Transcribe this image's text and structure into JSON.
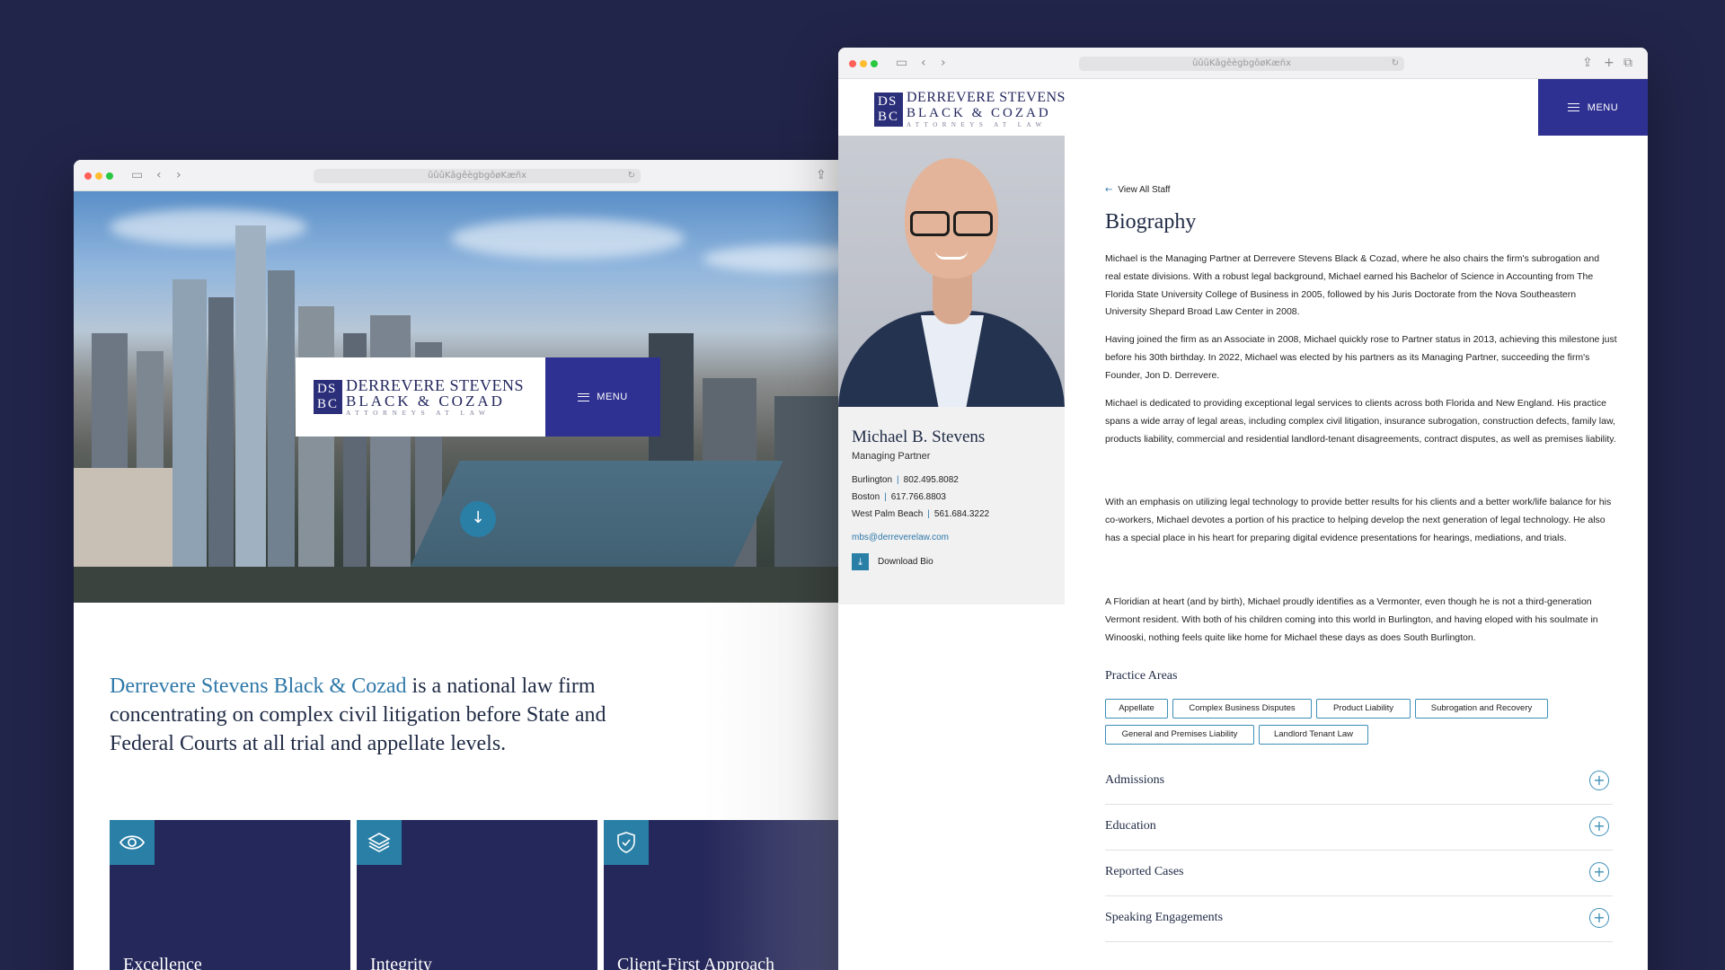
{
  "colors": {
    "background": "#22254a",
    "navy": "#2f3192",
    "accent": "#2a7fa6",
    "link": "#2e78a8"
  },
  "browser": {
    "address_text": "ûûûKâgêègbgôøKæñx"
  },
  "logo": {
    "mono_tl": "D",
    "mono_tr": "S",
    "mono_bl": "B",
    "mono_br": "C",
    "line1": "DERREVERE STEVENS",
    "line2": "BLACK & COZAD",
    "line3": "ATTORNEYS AT LAW"
  },
  "home": {
    "menu_label": "MENU",
    "intro_highlight": "Derrevere Stevens Black & Cozad",
    "intro_rest": " is a national law firm concentrating on complex civil litigation before State and Federal Courts at all trial and appellate levels.",
    "cards": [
      {
        "title": "Excellence",
        "icon": "eye-icon"
      },
      {
        "title": "Integrity",
        "icon": "layers-icon"
      },
      {
        "title": "Client-First Approach",
        "icon": "shield-check-icon"
      }
    ]
  },
  "profile": {
    "menu_label": "MENU",
    "name": "Michael B. Stevens",
    "title": "Managing Partner",
    "contacts": [
      {
        "city": "Burlington",
        "phone": "802.495.8082"
      },
      {
        "city": "Boston",
        "phone": "617.766.8803"
      },
      {
        "city": "West Palm Beach",
        "phone": "561.684.3222"
      }
    ],
    "email": "mbs@derreverelaw.com",
    "download_label": "Download Bio",
    "back_label": "View All Staff",
    "bio_heading": "Biography",
    "paragraphs": [
      "Michael is the Managing Partner at Derrevere Stevens Black & Cozad, where he also chairs the firm's subrogation and real estate divisions. With a robust legal background, Michael earned his Bachelor of Science in Accounting from The Florida State University College of Business in 2005, followed by his Juris Doctorate from the Nova Southeastern University Shepard Broad Law Center in 2008.",
      "Having joined the firm as an Associate in 2008, Michael quickly rose to Partner status in 2013, achieving this milestone just before his 30th birthday. In 2022, Michael was elected by his partners as its Managing Partner, succeeding the firm's Founder, Jon D. Derrevere.",
      "Michael is dedicated to providing exceptional legal services to clients across both Florida and New England. His practice spans a wide array of legal areas, including complex civil litigation, insurance subrogation, construction defects, family law, products liability, commercial and residential landlord-tenant disagreements, contract disputes, as well as premises liability.",
      "With an emphasis on utilizing legal technology to provide better results for his clients and a better work/life balance for his co-workers, Michael devotes a portion of his practice to helping develop the next generation of legal technology. He also has a special place in his heart for preparing digital evidence presentations for hearings, mediations, and trials.",
      "A Floridian at heart (and by birth), Michael proudly identifies as a Vermonter, even though he is not a third-generation Vermont resident. With both of his children coming into this world in Burlington, and having eloped with his soulmate in Winooski, nothing feels quite like home for Michael these days as does South Burlington."
    ],
    "practice_heading": "Practice Areas",
    "practice_areas": [
      "Appellate",
      "Complex Business Disputes",
      "Product Liability",
      "Subrogation and Recovery",
      "General and Premises Liability",
      "Landlord Tenant Law"
    ],
    "accordion": [
      "Admissions",
      "Education",
      "Reported Cases",
      "Speaking Engagements"
    ]
  }
}
